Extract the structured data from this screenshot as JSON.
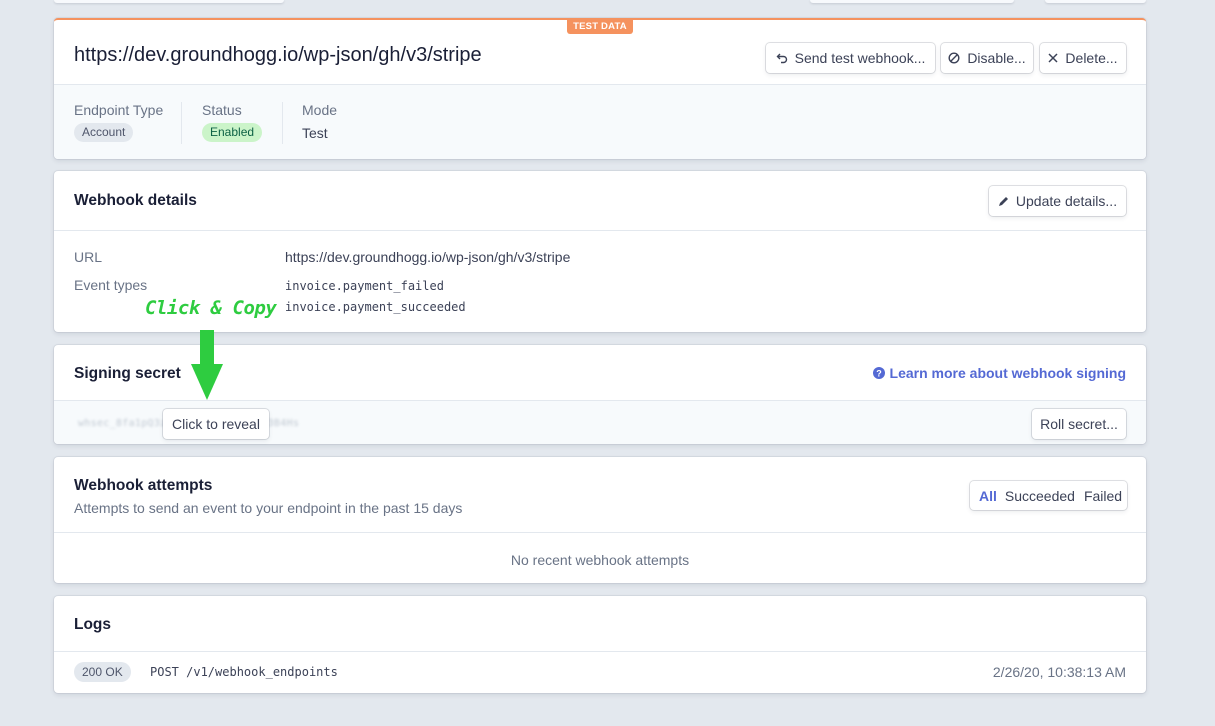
{
  "colors": {
    "background": "#e3e8ee",
    "test_badge": "#f5925e",
    "enabled_bg": "#cbf4c9",
    "enabled_text": "#0e6245",
    "link": "#5469d4",
    "annotation": "#2ecc40"
  },
  "header": {
    "badge": "TEST DATA",
    "endpoint_url": "https://dev.groundhogg.io/wp-json/gh/v3/stripe",
    "buttons": {
      "send_test": "Send test webhook...",
      "disable": "Disable...",
      "delete": "Delete..."
    },
    "meta": [
      {
        "label": "Endpoint Type",
        "value": "Account"
      },
      {
        "label": "Status",
        "value": "Enabled"
      },
      {
        "label": "Mode",
        "value": "Test"
      }
    ]
  },
  "details": {
    "title": "Webhook details",
    "update_button": "Update details...",
    "url_label": "URL",
    "url_value": "https://dev.groundhogg.io/wp-json/gh/v3/stripe",
    "event_types_label": "Event types",
    "event_types": [
      "invoice.payment_failed",
      "invoice.payment_succeeded"
    ]
  },
  "annotation": {
    "text": "Click & Copy"
  },
  "signing": {
    "title": "Signing secret",
    "learn_more": "Learn more about webhook signing",
    "masked_secret": "whsec_8fa1pQ3zK9xR7mN2dL5cS98a3B4Hs",
    "reveal_button": "Click to reveal",
    "roll_button": "Roll secret..."
  },
  "attempts": {
    "title": "Webhook attempts",
    "subtitle": "Attempts to send an event to your endpoint in the past 15 days",
    "filters": [
      "All",
      "Succeeded",
      "Failed"
    ],
    "empty_text": "No recent webhook attempts"
  },
  "logs": {
    "title": "Logs",
    "entries": [
      {
        "status": "200 OK",
        "request": "POST /v1/webhook_endpoints",
        "time": "2/26/20, 10:38:13 AM"
      }
    ]
  }
}
